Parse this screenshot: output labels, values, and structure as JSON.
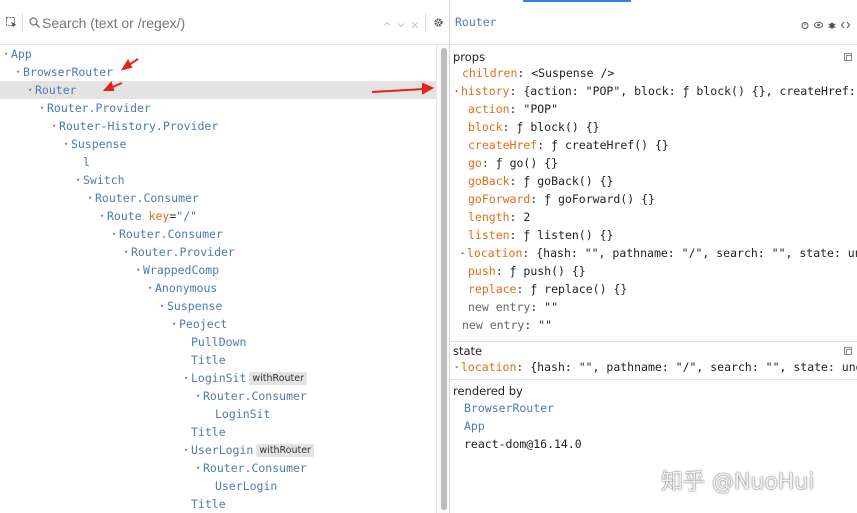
{
  "search": {
    "placeholder": "Search (text or /regex/)"
  },
  "tree": [
    {
      "label": "App",
      "depth": 0,
      "arrow": true
    },
    {
      "label": "BrowserRouter",
      "depth": 1,
      "arrow": true
    },
    {
      "label": "Router",
      "depth": 2,
      "arrow": true,
      "selected": true
    },
    {
      "label": "Router.Provider",
      "depth": 3,
      "arrow": true
    },
    {
      "label": "Router-History.Provider",
      "depth": 4,
      "arrow": true
    },
    {
      "label": "Suspense",
      "depth": 5,
      "arrow": true
    },
    {
      "label": "l",
      "depth": 6,
      "arrow": false
    },
    {
      "label": "Switch",
      "depth": 6,
      "arrow": true
    },
    {
      "label": "Router.Consumer",
      "depth": 7,
      "arrow": true
    },
    {
      "label": "Route",
      "depth": 8,
      "arrow": true,
      "prop_key": "key",
      "prop_eq": "=",
      "prop_val": "\"/\""
    },
    {
      "label": "Router.Consumer",
      "depth": 9,
      "arrow": true
    },
    {
      "label": "Router.Provider",
      "depth": 10,
      "arrow": true
    },
    {
      "label": "WrappedComp",
      "depth": 11,
      "arrow": true
    },
    {
      "label": "Anonymous",
      "depth": 12,
      "arrow": true
    },
    {
      "label": "Suspense",
      "depth": 13,
      "arrow": true
    },
    {
      "label": "Peoject",
      "depth": 14,
      "arrow": true
    },
    {
      "label": "PullDown",
      "depth": 15,
      "arrow": false
    },
    {
      "label": "Title",
      "depth": 15,
      "arrow": false
    },
    {
      "label": "LoginSit",
      "depth": 15,
      "arrow": true,
      "badge": "withRouter"
    },
    {
      "label": "Router.Consumer",
      "depth": 16,
      "arrow": true
    },
    {
      "label": "LoginSit",
      "depth": 17,
      "arrow": false
    },
    {
      "label": "Title",
      "depth": 15,
      "arrow": false
    },
    {
      "label": "UserLogin",
      "depth": 15,
      "arrow": true,
      "badge": "withRouter"
    },
    {
      "label": "Router.Consumer",
      "depth": 16,
      "arrow": true
    },
    {
      "label": "UserLogin",
      "depth": 17,
      "arrow": false
    },
    {
      "label": "Title",
      "depth": 15,
      "arrow": false
    }
  ],
  "right": {
    "component_name": "Router",
    "props_header": "props",
    "props": [
      {
        "key": "children",
        "sep": ": ",
        "value": "<Suspense />",
        "indent": 1,
        "arrow": false
      },
      {
        "key": "history",
        "sep": ": ",
        "value": "{action: \"POP\", block: ƒ block() {}, createHref: ƒ createHre…",
        "indent": 0,
        "arrow": true
      },
      {
        "key": "action",
        "sep": ": ",
        "value": "\"POP\"",
        "indent": 2,
        "arrow": false
      },
      {
        "key": "block",
        "sep": ": ",
        "value": "ƒ block() {}",
        "indent": 2,
        "arrow": false
      },
      {
        "key": "createHref",
        "sep": ": ",
        "value": "ƒ createHref() {}",
        "indent": 2,
        "arrow": false
      },
      {
        "key": "go",
        "sep": ": ",
        "value": "ƒ go() {}",
        "indent": 2,
        "arrow": false
      },
      {
        "key": "goBack",
        "sep": ": ",
        "value": "ƒ goBack() {}",
        "indent": 2,
        "arrow": false
      },
      {
        "key": "goForward",
        "sep": ": ",
        "value": "ƒ goForward() {}",
        "indent": 2,
        "arrow": false
      },
      {
        "key": "length",
        "sep": ": ",
        "value": "2",
        "indent": 2,
        "arrow": false
      },
      {
        "key": "listen",
        "sep": ": ",
        "value": "ƒ listen() {}",
        "indent": 2,
        "arrow": false
      },
      {
        "key": "location",
        "sep": ": ",
        "value": "{hash: \"\", pathname: \"/\", search: \"\", state: undefined}",
        "indent": 1,
        "arrow": true
      },
      {
        "key": "push",
        "sep": ": ",
        "value": "ƒ push() {}",
        "indent": 2,
        "arrow": false
      },
      {
        "key": "replace",
        "sep": ": ",
        "value": "ƒ replace() {}",
        "indent": 2,
        "arrow": false
      },
      {
        "key": "new entry",
        "sep": ": ",
        "value": "\"\"",
        "indent": 2,
        "arrow": false,
        "plain": true
      },
      {
        "key": "new entry",
        "sep": ": ",
        "value": "\"\"",
        "indent": 1,
        "arrow": false,
        "plain": true
      }
    ],
    "state_header": "state",
    "state": [
      {
        "key": "location",
        "sep": ": ",
        "value": "{hash: \"\", pathname: \"/\", search: \"\", state: undefined}",
        "indent": 0,
        "arrow": true
      }
    ],
    "rendered_by_header": "rendered by",
    "rendered_by": [
      {
        "label": "BrowserRouter",
        "link": true
      },
      {
        "label": "App",
        "link": true
      },
      {
        "label": "react-dom@16.14.0",
        "link": false
      }
    ]
  },
  "watermark": "知乎 @NuoHui",
  "colors": {
    "component": "#4c7ab6",
    "prop_key": "#e36c19",
    "annotation_arrow": "#e0241c",
    "selection": "#e3e3e3",
    "accent": "#2f80ed"
  }
}
